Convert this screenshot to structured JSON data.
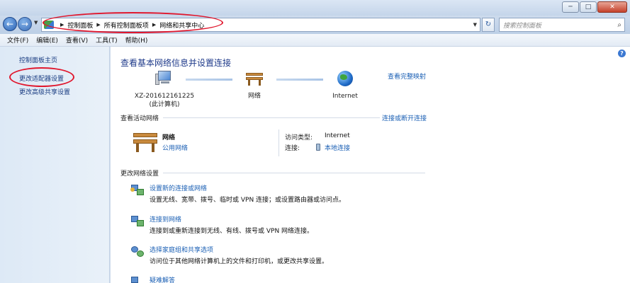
{
  "window": {
    "minimize_label": "─",
    "maximize_label": "□",
    "close_label": "✕"
  },
  "address": {
    "crumbs": [
      "控制面板",
      "所有控制面板项",
      "网络和共享中心"
    ],
    "search_placeholder": "搜索控制面板"
  },
  "menu": [
    "文件(F)",
    "编辑(E)",
    "查看(V)",
    "工具(T)",
    "帮助(H)"
  ],
  "sidebar": {
    "home": "控制面板主页",
    "items": [
      "更改适配器设置",
      "更改高级共享设置"
    ]
  },
  "main": {
    "title": "查看基本网络信息并设置连接",
    "see_full_map": "查看完整映射",
    "map": {
      "computer_name": "XZ-201612161225",
      "computer_sub": "(此计算机)",
      "network": "网络",
      "internet": "Internet"
    },
    "active_networks": {
      "header": "查看活动网络",
      "connect_link": "连接或断开连接",
      "network_name": "网络",
      "network_type": "公用网络",
      "access_type_label": "访问类型:",
      "access_type_value": "Internet",
      "connection_label": "连接:",
      "connection_value": "本地连接"
    },
    "change_settings": {
      "header": "更改网络设置",
      "tasks": [
        {
          "title": "设置新的连接或网络",
          "desc": "设置无线、宽带、拨号、临时或 VPN 连接；或设置路由器或访问点。"
        },
        {
          "title": "连接到网络",
          "desc": "连接到或重新连接到无线、有线、拨号或 VPN 网络连接。"
        },
        {
          "title": "选择家庭组和共享选项",
          "desc": "访问位于其他网络计算机上的文件和打印机，或更改共享设置。"
        },
        {
          "title": "疑难解答",
          "desc": ""
        }
      ]
    }
  }
}
